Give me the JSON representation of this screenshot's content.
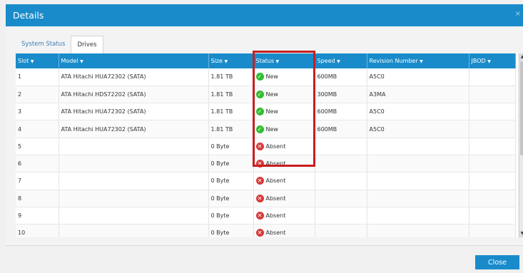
{
  "dialog": {
    "title": "Details",
    "close_glyph": "×"
  },
  "tabs": [
    {
      "label": "System Status",
      "active": false
    },
    {
      "label": "Drives",
      "active": true
    }
  ],
  "table": {
    "columns": [
      {
        "label": "Slot",
        "arrow": "▼"
      },
      {
        "label": "Model",
        "arrow": "▼"
      },
      {
        "label": "Size",
        "arrow": "▼"
      },
      {
        "label": "Status",
        "arrow": "▼"
      },
      {
        "label": "Speed",
        "arrow": "▼"
      },
      {
        "label": "Revision Number",
        "arrow": "▼"
      },
      {
        "label": "JBOD",
        "arrow": "▼"
      }
    ],
    "rows": [
      {
        "slot": "1",
        "model": "ATA Hitachi HUA72302 (SATA)",
        "size": "1.81 TB",
        "status": "New",
        "status_icon": "check-circle-icon",
        "speed": "600MB",
        "revision": "A5C0",
        "jbod": ""
      },
      {
        "slot": "2",
        "model": "ATA Hitachi HDS72202 (SATA)",
        "size": "1.81 TB",
        "status": "New",
        "status_icon": "check-circle-icon",
        "speed": "300MB",
        "revision": "A3MA",
        "jbod": ""
      },
      {
        "slot": "3",
        "model": "ATA Hitachi HUA72302 (SATA)",
        "size": "1.81 TB",
        "status": "New",
        "status_icon": "check-circle-icon",
        "speed": "600MB",
        "revision": "A5C0",
        "jbod": ""
      },
      {
        "slot": "4",
        "model": "ATA Hitachi HUA72302 (SATA)",
        "size": "1.81 TB",
        "status": "New",
        "status_icon": "check-circle-icon",
        "speed": "600MB",
        "revision": "A5C0",
        "jbod": ""
      },
      {
        "slot": "5",
        "model": "",
        "size": "0 Byte",
        "status": "Absent",
        "status_icon": "x-circle-icon",
        "speed": "",
        "revision": "",
        "jbod": ""
      },
      {
        "slot": "6",
        "model": "",
        "size": "0 Byte",
        "status": "Absent",
        "status_icon": "x-circle-icon",
        "speed": "",
        "revision": "",
        "jbod": ""
      },
      {
        "slot": "7",
        "model": "",
        "size": "0 Byte",
        "status": "Absent",
        "status_icon": "x-circle-icon",
        "speed": "",
        "revision": "",
        "jbod": ""
      },
      {
        "slot": "8",
        "model": "",
        "size": "0 Byte",
        "status": "Absent",
        "status_icon": "x-circle-icon",
        "speed": "",
        "revision": "",
        "jbod": ""
      },
      {
        "slot": "9",
        "model": "",
        "size": "0 Byte",
        "status": "Absent",
        "status_icon": "x-circle-icon",
        "speed": "",
        "revision": "",
        "jbod": ""
      },
      {
        "slot": "10",
        "model": "",
        "size": "0 Byte",
        "status": "Absent",
        "status_icon": "x-circle-icon",
        "speed": "",
        "revision": "",
        "jbod": ""
      }
    ]
  },
  "footer": {
    "close_label": "Close"
  },
  "colors": {
    "accent": "#1a8bca",
    "highlight": "#c81e1e",
    "ok": "#2fbf2f",
    "error": "#d93a3a"
  }
}
